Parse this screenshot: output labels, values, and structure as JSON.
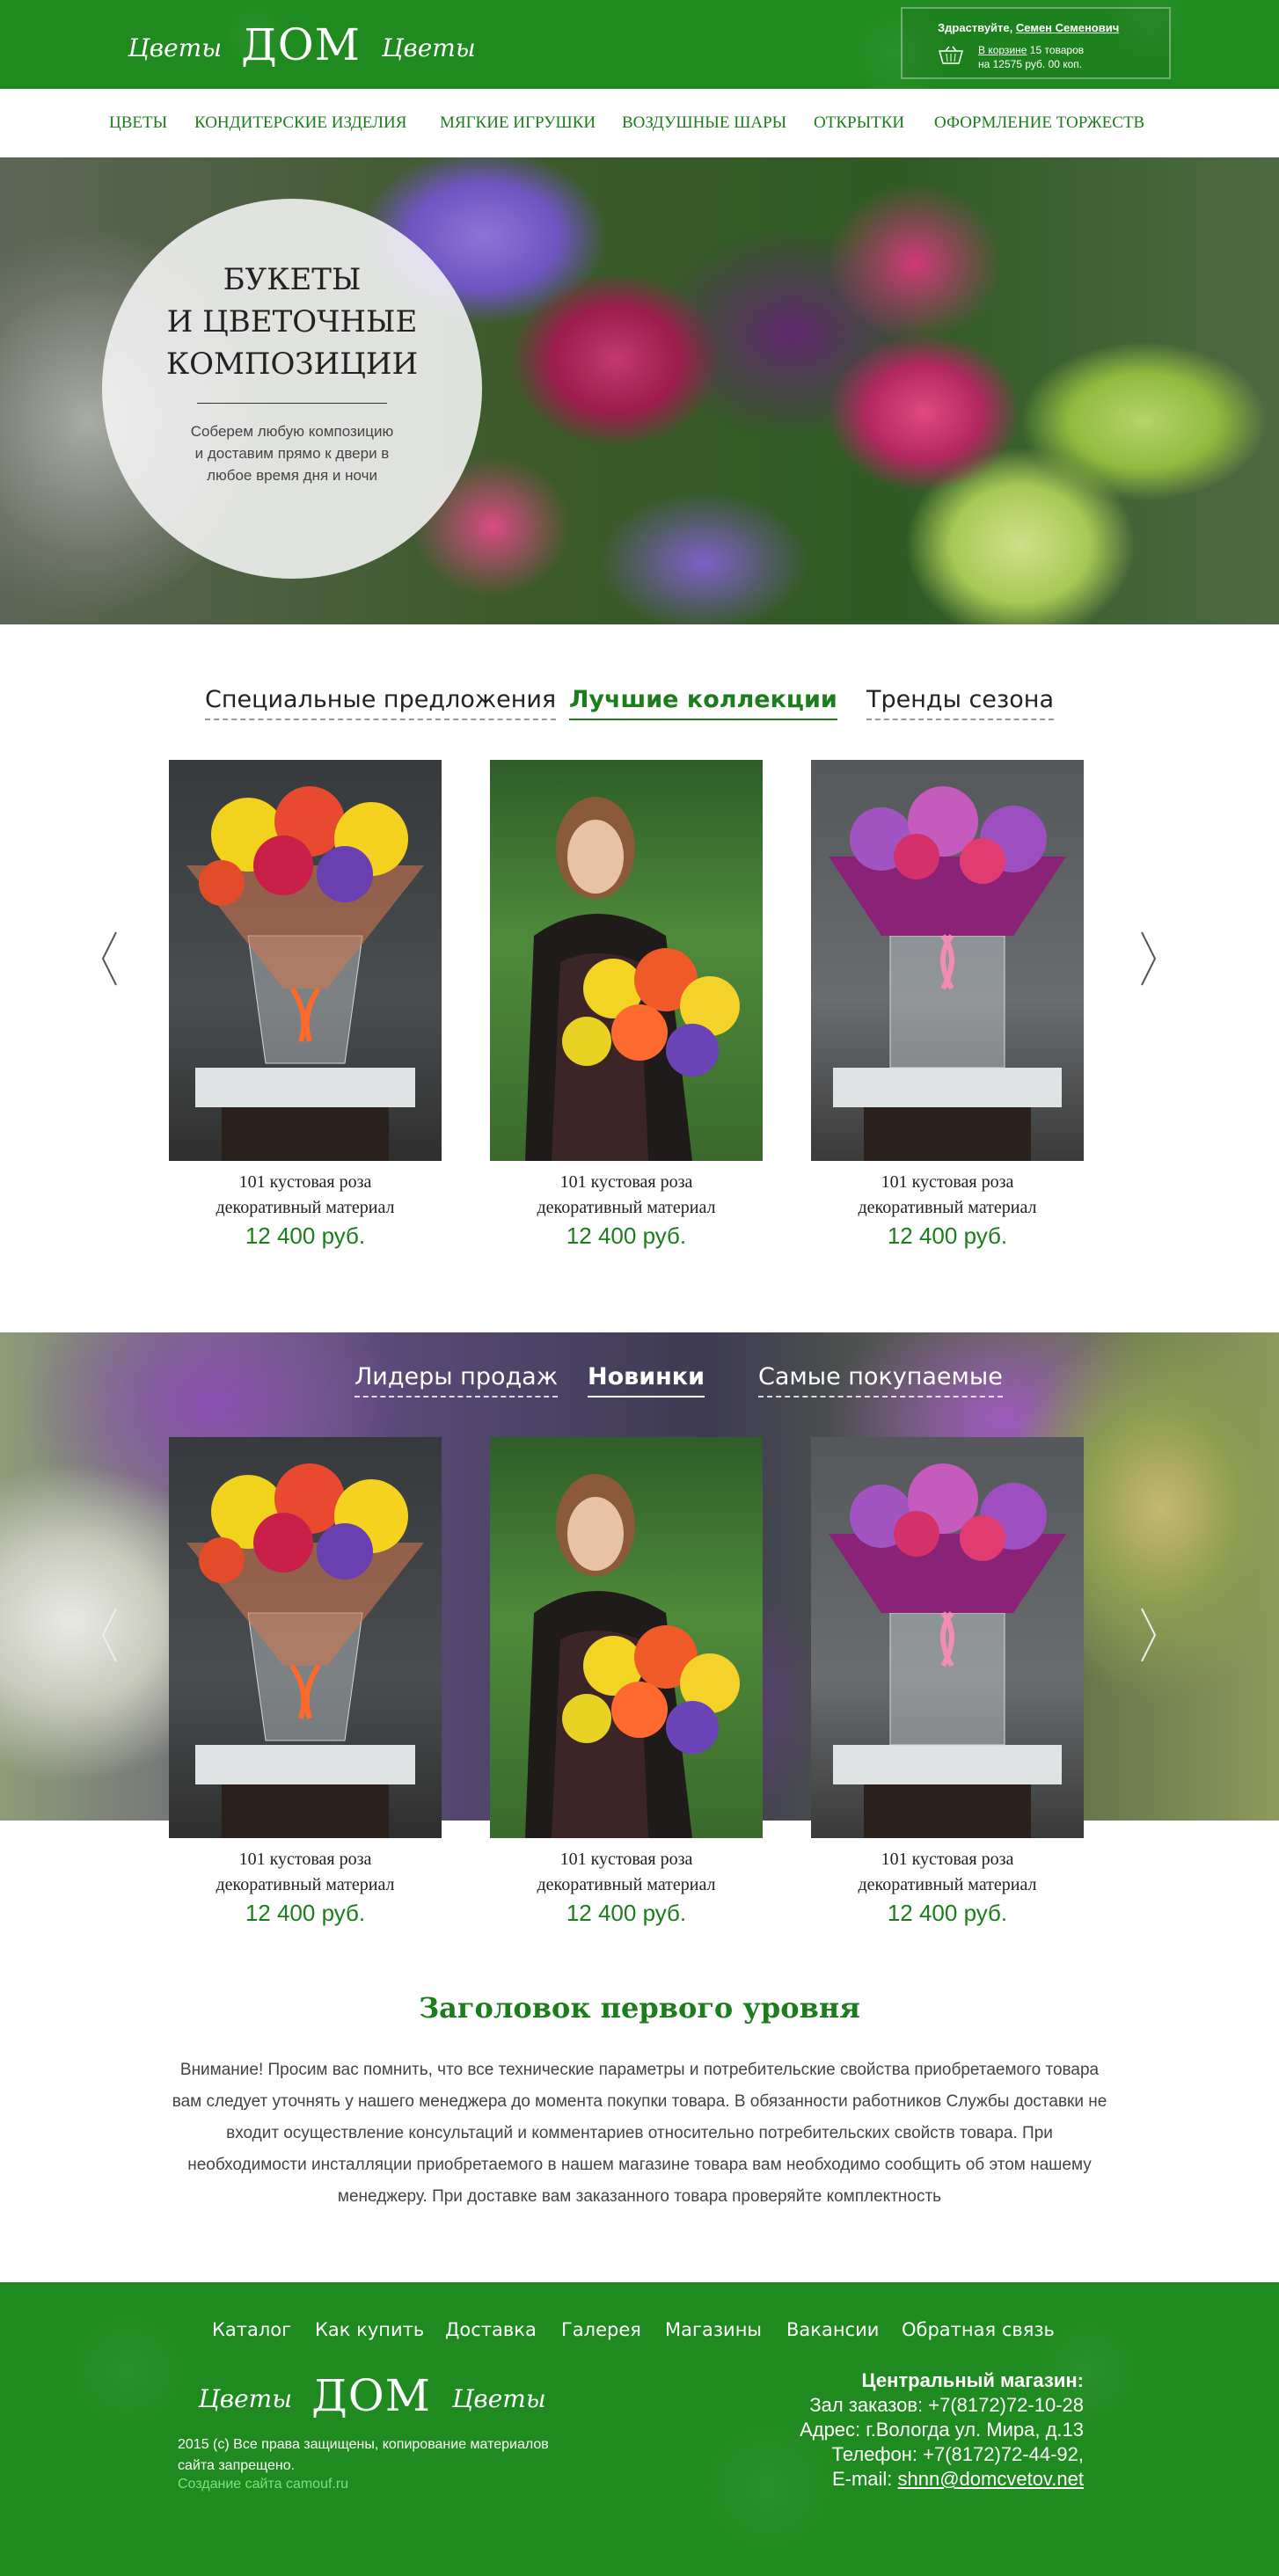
{
  "brand": {
    "logo_left": "Цветы",
    "logo_center": "ДОМ",
    "logo_right": "Цветы"
  },
  "header": {
    "greeting": "Здраствуйте,",
    "user_name": "Семен Семенович",
    "cart_link": "В корзине",
    "cart_count": "15 товаров",
    "cart_total": "на 12575 руб. 00 коп."
  },
  "nav": {
    "items": [
      {
        "label": "Цветы"
      },
      {
        "label": "Кондитерские изделия"
      },
      {
        "label": "Мягкие игрушки"
      },
      {
        "label": "Воздушные шары"
      },
      {
        "label": "Открытки"
      },
      {
        "label": "Оформление торжеств"
      }
    ]
  },
  "hero": {
    "title_line1": "Букеты",
    "title_line2": "и цветочные",
    "title_line3": "композиции",
    "subtitle": "Соберем любую композицию и доставим прямо к двери в любое время дня и ночи"
  },
  "collections": {
    "tabs": [
      {
        "label": "Специальные предложения"
      },
      {
        "label": "Лучшие коллекции"
      },
      {
        "label": "Тренды сезона"
      }
    ],
    "products": [
      {
        "name_line1": "101 кустовая роза",
        "name_line2": "декоративный материал",
        "price": "12 400 руб."
      },
      {
        "name_line1": "101 кустовая роза",
        "name_line2": "декоративный материал",
        "price": "12 400 руб."
      },
      {
        "name_line1": "101 кустовая роза",
        "name_line2": "декоративный материал",
        "price": "12 400 руб."
      }
    ]
  },
  "sales": {
    "tabs": [
      {
        "label": "Лидеры продаж"
      },
      {
        "label": "Новинки"
      },
      {
        "label": "Самые покупаемые"
      }
    ],
    "products": [
      {
        "name_line1": "101 кустовая роза",
        "name_line2": "декоративный материал",
        "price": "12 400 руб."
      },
      {
        "name_line1": "101 кустовая роза",
        "name_line2": "декоративный материал",
        "price": "12 400 руб."
      },
      {
        "name_line1": "101 кустовая роза",
        "name_line2": "декоративный материал",
        "price": "12 400 руб."
      }
    ]
  },
  "seo": {
    "title": "Заголовок первого уровня",
    "text": "Внимание! Просим вас помнить, что все технические параметры и потребительские свойства приобретаемого товара вам следует уточнять у нашего менеджера до момента покупки товара. В обязанности работников Службы доставки не входит осуществление консультаций и комментариев относительно потребительских свойств товара. При необходимости инсталляции приобретаемого в нашем магазине товара вам необходимо сообщить об этом нашему менеджеру. При доставке вам заказанного товара проверяйте комплектность"
  },
  "footer": {
    "links": [
      {
        "label": "Каталог"
      },
      {
        "label": "Как купить"
      },
      {
        "label": "Доставка"
      },
      {
        "label": "Галерея"
      },
      {
        "label": "Магазины"
      },
      {
        "label": "Вакансии"
      },
      {
        "label": "Обратная связь"
      }
    ],
    "copyright": "2015 (c) Все права защищены, копирование материалов сайта запрещено.",
    "credit": "Создание сайта camouf.ru",
    "store_title": "Центральный магазин:",
    "orders_phone": "Зал заказов: +7(8172)72-10-28",
    "address": "Адрес: г.Вологда ул. Мира, д.13",
    "phone": "Телефон: +7(8172)72-44-92,",
    "email_label": "E-mail:",
    "email": "shnn@domcvetov.net"
  },
  "colors": {
    "brand_green": "#1f8a1f",
    "accent_green": "#1b7d1b"
  },
  "icons": [
    "cart-icon",
    "arrow-left-icon",
    "arrow-right-icon"
  ]
}
